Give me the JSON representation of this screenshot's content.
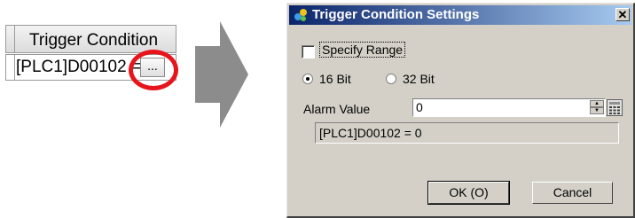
{
  "table": {
    "header": "Trigger Condition",
    "cell_value": "[PLC1]D00102 =",
    "ellipsis_label": "..."
  },
  "dialog": {
    "title": "Trigger Condition Settings",
    "close_label": "✕",
    "specify_range": {
      "label": "Specify Range",
      "checked": false
    },
    "radio_16": {
      "label": "16 Bit",
      "selected": true
    },
    "radio_32": {
      "label": "32 Bit",
      "selected": false
    },
    "alarm_value": {
      "label": "Alarm Value",
      "value": "0"
    },
    "result_text": "[PLC1]D00102 = 0",
    "ok_label": "OK (O)",
    "cancel_label": "Cancel"
  },
  "colors": {
    "highlight_ring": "#e8141c",
    "titlebar": "#0a246a",
    "arrow": "#8c8c8c"
  }
}
